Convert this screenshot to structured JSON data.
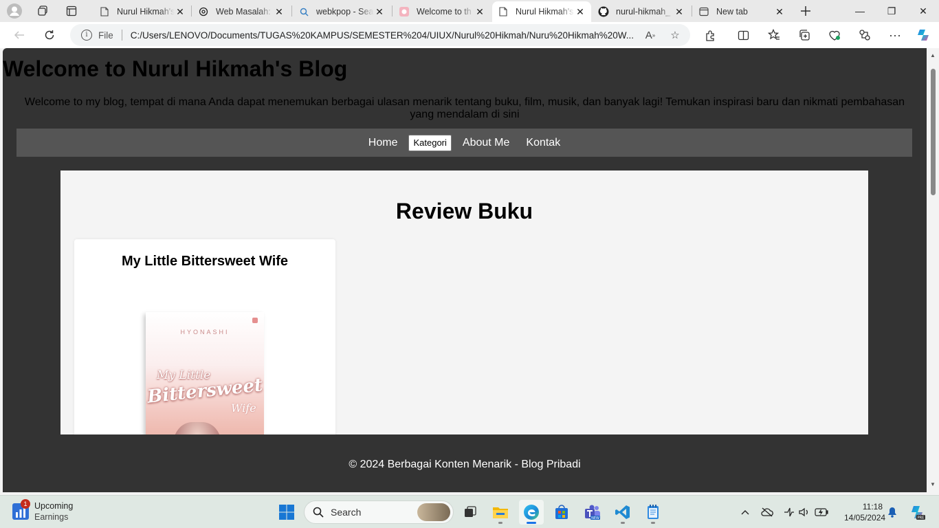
{
  "browser": {
    "tabs": [
      {
        "title": "Nurul Hikmah's",
        "favicon": "document-icon"
      },
      {
        "title": "Web Masalah: I",
        "favicon": "chatgpt-icon"
      },
      {
        "title": "webkpop - Sea",
        "favicon": "search-icon"
      },
      {
        "title": "Welcome to th",
        "favicon": "app-icon"
      },
      {
        "title": "Nurul Hikmah's",
        "favicon": "document-icon",
        "active": true
      },
      {
        "title": "nurul-hikmah_",
        "favicon": "github-icon"
      },
      {
        "title": "New tab",
        "favicon": "newtab-icon"
      }
    ],
    "address": {
      "scheme_label": "File",
      "url": "C:/Users/LENOVO/Documents/TUGAS%20KAMPUS/SEMESTER%204/UIUX/Nurul%20Hikmah/Nuru%20Hikmah%20W..."
    },
    "window_controls": {
      "minimize": "—",
      "restore": "❐",
      "close": "✕"
    }
  },
  "page": {
    "title": "Welcome to Nurul Hikmah's Blog",
    "intro": "Welcome to my blog, tempat di mana Anda dapat menemukan berbagai ulasan menarik tentang buku, film, musik, dan banyak lagi! Temukan inspirasi baru dan nikmati pembahasan yang mendalam di sini",
    "nav": {
      "home": "Home",
      "kategori": "Kategori",
      "about": "About Me",
      "kontak": "Kontak"
    },
    "section_title": "Review Buku",
    "card": {
      "title": "My Little Bittersweet Wife",
      "cover_author": "HYONASHI",
      "cover_line1": "My Little",
      "cover_line2": "Bittersweet",
      "cover_line3": "Wife"
    },
    "footer": "© 2024 Berbagai Konten Menarik - Blog Pribadi"
  },
  "taskbar": {
    "widget": {
      "badge": "1",
      "line1": "Upcoming",
      "line2": "Earnings"
    },
    "search_label": "Search",
    "clock": {
      "time": "11:18",
      "date": "14/05/2024"
    }
  },
  "colors": {
    "page_bg": "#333333",
    "nav_bg": "#555555",
    "panel_bg": "#f4f4f4"
  }
}
